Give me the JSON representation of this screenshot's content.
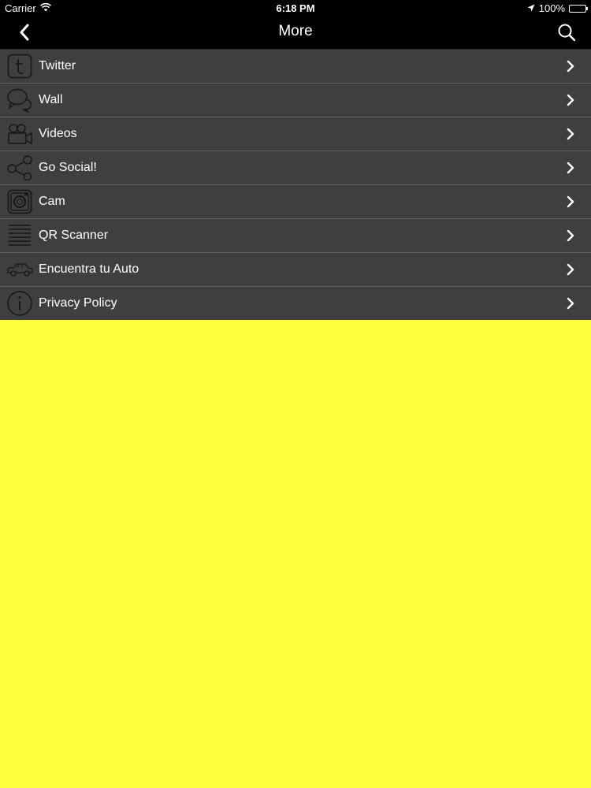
{
  "status_bar": {
    "carrier": "Carrier",
    "time": "6:18 PM",
    "battery": "100%",
    "wifi_icon": "wifi-icon",
    "location_icon": "location-arrow-icon",
    "battery_icon": "battery-icon"
  },
  "navbar": {
    "title": "More",
    "back_icon": "chevron-left-icon",
    "search_icon": "search-icon"
  },
  "menu": {
    "items": [
      {
        "label": "Twitter",
        "icon": "tumblr-t-icon"
      },
      {
        "label": "Wall",
        "icon": "speech-bubbles-icon"
      },
      {
        "label": "Videos",
        "icon": "video-camera-icon"
      },
      {
        "label": "Go Social!",
        "icon": "share-icon"
      },
      {
        "label": "Cam",
        "icon": "camera-icon"
      },
      {
        "label": "QR Scanner",
        "icon": "scanner-lines-icon"
      },
      {
        "label": "Encuentra tu Auto",
        "icon": "car-icon"
      },
      {
        "label": "Privacy Policy",
        "icon": "info-icon"
      }
    ],
    "chevron_icon": "chevron-right-icon"
  },
  "colors": {
    "background": "#ffff3d",
    "bar": "#000000",
    "row": "#3f3e41",
    "divider": "#636265",
    "text": "#ffffff"
  }
}
